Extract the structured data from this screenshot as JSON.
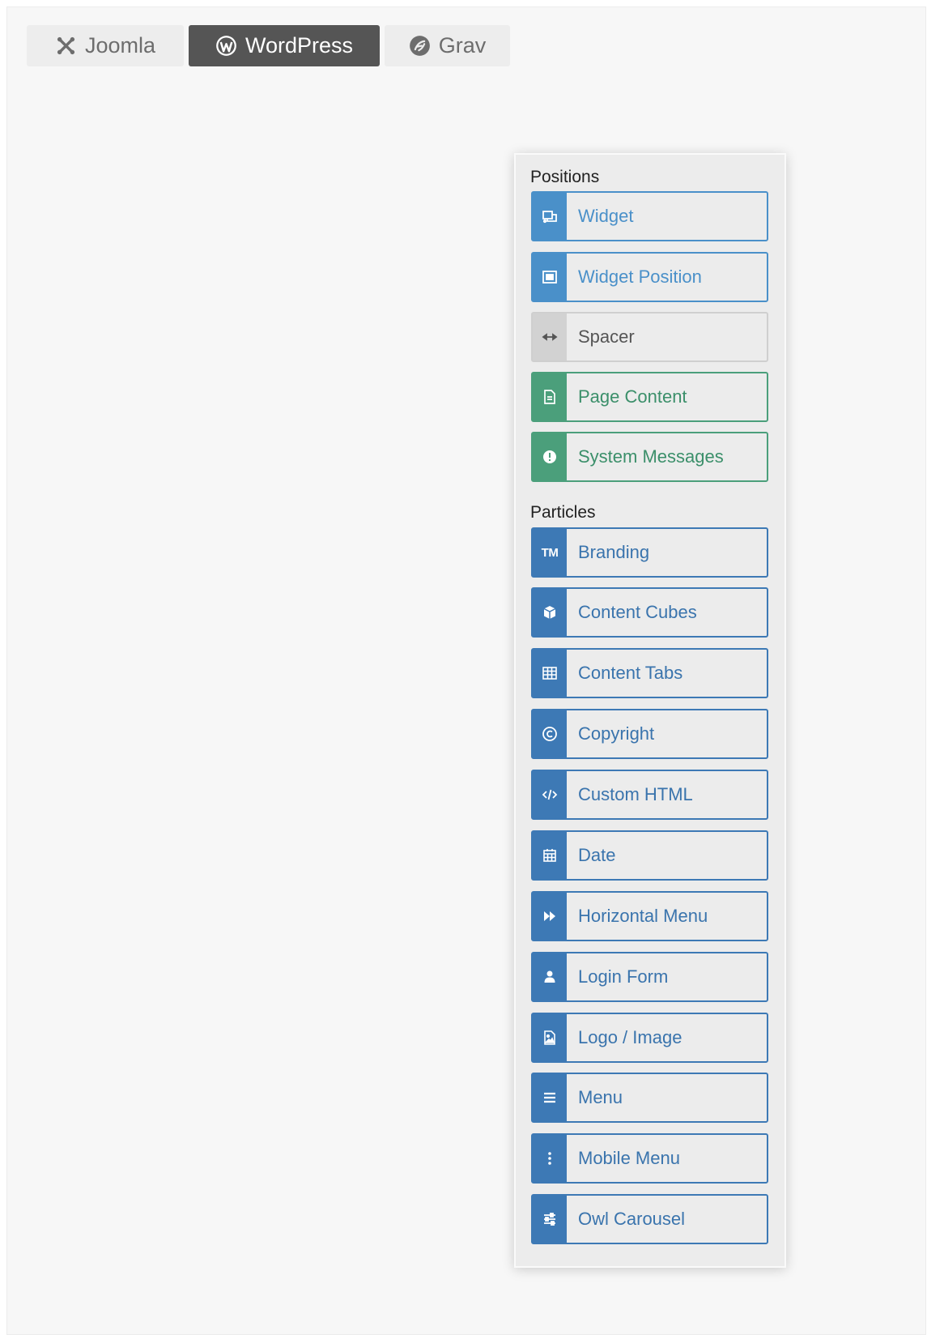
{
  "tabs": [
    {
      "label": "Joomla",
      "icon": "joomla-icon",
      "active": false
    },
    {
      "label": "WordPress",
      "icon": "wordpress-icon",
      "active": true
    },
    {
      "label": "Grav",
      "icon": "grav-icon",
      "active": false
    }
  ],
  "panel": {
    "positions_heading": "Positions",
    "positions": [
      {
        "label": "Widget",
        "icon": "widget-icon",
        "color": "#4a90c9"
      },
      {
        "label": "Widget Position",
        "icon": "widget-position-icon",
        "color": "#4a90c9"
      },
      {
        "label": "Spacer",
        "icon": "arrows-horizontal-icon",
        "color": "#d2d2d2"
      },
      {
        "label": "Page Content",
        "icon": "file-text-icon",
        "color": "#4b9f7b"
      },
      {
        "label": "System Messages",
        "icon": "exclamation-circle-icon",
        "color": "#4b9f7b"
      }
    ],
    "particles_heading": "Particles",
    "particles": [
      {
        "label": "Branding",
        "icon": "trademark-icon",
        "icon_text": "TM"
      },
      {
        "label": "Content Cubes",
        "icon": "cube-icon"
      },
      {
        "label": "Content Tabs",
        "icon": "table-icon"
      },
      {
        "label": "Copyright",
        "icon": "copyright-icon"
      },
      {
        "label": "Custom HTML",
        "icon": "code-icon"
      },
      {
        "label": "Date",
        "icon": "calendar-icon"
      },
      {
        "label": "Horizontal Menu",
        "icon": "fast-forward-icon"
      },
      {
        "label": "Login Form",
        "icon": "user-icon"
      },
      {
        "label": "Logo / Image",
        "icon": "image-icon"
      },
      {
        "label": "Menu",
        "icon": "bars-icon"
      },
      {
        "label": "Mobile Menu",
        "icon": "ellipsis-vertical-icon"
      },
      {
        "label": "Owl Carousel",
        "icon": "sliders-icon"
      }
    ],
    "particle_color": "#3d79b5"
  }
}
